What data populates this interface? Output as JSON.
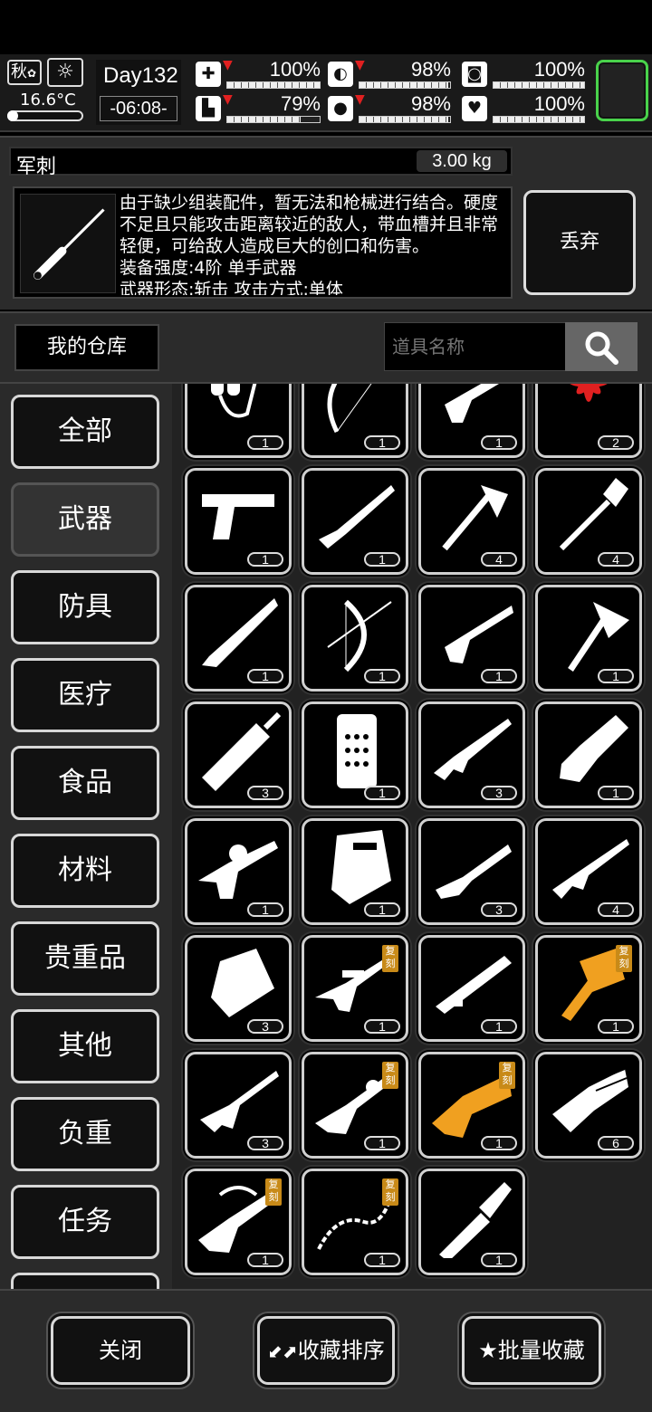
{
  "hud": {
    "season": "秋",
    "temperature": "16.6°C",
    "day": "Day132",
    "time": "-06:08-",
    "stats": [
      {
        "name": "health-icon",
        "value": "100%",
        "level": 1.0,
        "down": true
      },
      {
        "name": "stomach-icon",
        "value": "98%",
        "level": 0.98,
        "down": true
      },
      {
        "name": "armor-icon",
        "value": "100%",
        "level": 1.0,
        "down": false
      },
      {
        "name": "stamina-icon",
        "value": "79%",
        "level": 0.79,
        "down": true
      },
      {
        "name": "water-icon",
        "value": "98%",
        "level": 0.98,
        "down": true
      },
      {
        "name": "heart-icon",
        "value": "100%",
        "level": 1.0,
        "down": false
      }
    ]
  },
  "detail": {
    "name": "军刺",
    "weight": "3.00 kg",
    "description": "由于缺少组装配件，暂无法和枪械进行结合。硬度不足且只能攻击距离较近的敌人，带血槽并且非常轻便，可给敌人造成巨大的创口和伤害。\n装备强度:4阶 单手武器\n武器形态:斩击 攻击方式:单体",
    "discard_label": "丢弃"
  },
  "warehouse": {
    "label": "我的仓库",
    "search_placeholder": "道具名称"
  },
  "categories": [
    "全部",
    "武器",
    "防具",
    "医疗",
    "食品",
    "材料",
    "贵重品",
    "其他",
    "负重",
    "任务"
  ],
  "active_category": "武器",
  "items": [
    {
      "icon": "flamethrower-icon",
      "count": "1"
    },
    {
      "icon": "recurve-bow-icon",
      "count": "1"
    },
    {
      "icon": "revolver-icon",
      "count": "1"
    },
    {
      "icon": "red-flower-icon",
      "count": "2",
      "color": "#e02020"
    },
    {
      "icon": "pistol-icon",
      "count": "1"
    },
    {
      "icon": "shotgun-icon",
      "count": "1"
    },
    {
      "icon": "hand-axe-icon",
      "count": "4"
    },
    {
      "icon": "shovel-icon",
      "count": "4"
    },
    {
      "icon": "machete-icon",
      "count": "1"
    },
    {
      "icon": "compound-bow-icon",
      "count": "1"
    },
    {
      "icon": "long-revolver-icon",
      "count": "1"
    },
    {
      "icon": "hatchet-icon",
      "count": "1"
    },
    {
      "icon": "broadsword-icon",
      "count": "3"
    },
    {
      "icon": "riot-shield-icon",
      "count": "1"
    },
    {
      "icon": "assault-rifle-icon",
      "count": "3"
    },
    {
      "icon": "chainsaw-icon",
      "count": "1"
    },
    {
      "icon": "grenade-launcher-rifle-icon",
      "count": "1"
    },
    {
      "icon": "ballistic-shield-icon",
      "count": "1"
    },
    {
      "icon": "pump-shotgun-icon",
      "count": "3"
    },
    {
      "icon": "battle-rifle-icon",
      "count": "4"
    },
    {
      "icon": "heavy-shield-icon",
      "count": "3"
    },
    {
      "icon": "sniper-rifle-replica-icon",
      "count": "1",
      "badge": "复刻"
    },
    {
      "icon": "rocket-launcher-icon",
      "count": "1"
    },
    {
      "icon": "golden-hammer-replica-icon",
      "count": "1",
      "badge": "复刻",
      "color": "#f0a020"
    },
    {
      "icon": "marksman-rifle-icon",
      "count": "3"
    },
    {
      "icon": "ornate-rifle-replica-icon",
      "count": "1",
      "badge": "复刻"
    },
    {
      "icon": "golden-gun-replica-icon",
      "count": "1",
      "badge": "复刻",
      "color": "#f0a020"
    },
    {
      "icon": "minigun-icon",
      "count": "6"
    },
    {
      "icon": "dragon-rifle-replica-icon",
      "count": "1",
      "badge": "复刻"
    },
    {
      "icon": "thorn-whip-replica-icon",
      "count": "1",
      "badge": "复刻"
    },
    {
      "icon": "combat-knife-icon",
      "count": "1"
    }
  ],
  "bottom": {
    "close_label": "关闭",
    "sort_label": "收藏排序",
    "batch_label": "批量收藏"
  }
}
